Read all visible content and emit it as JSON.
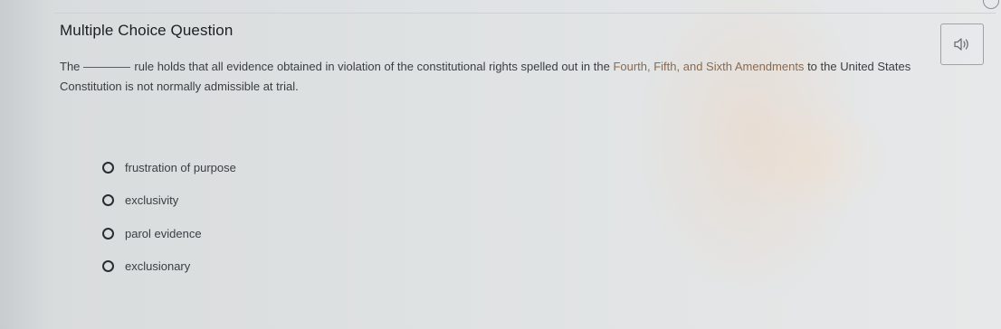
{
  "question_card": {
    "heading": "Multiple Choice Question",
    "audio_button_icon": "speaker-icon",
    "prompt": {
      "part1": "The",
      "part2": "rule holds that all evidence obtained in violation of the constitutional rights spelled out in the",
      "amendments": "Fourth, Fifth, and Sixth Amendments",
      "part3": "to the United States Constitution is not normally admissible at trial."
    },
    "options": [
      {
        "label": "frustration of purpose"
      },
      {
        "label": "exclusivity"
      },
      {
        "label": "parol evidence"
      },
      {
        "label": "exclusionary"
      }
    ]
  },
  "colors": {
    "heading": "#1c1f22",
    "body_text": "#3a3e42",
    "amendment_link": "#8a6a4f",
    "radio_border": "#2a2d30",
    "button_border": "#9ea3a8"
  }
}
